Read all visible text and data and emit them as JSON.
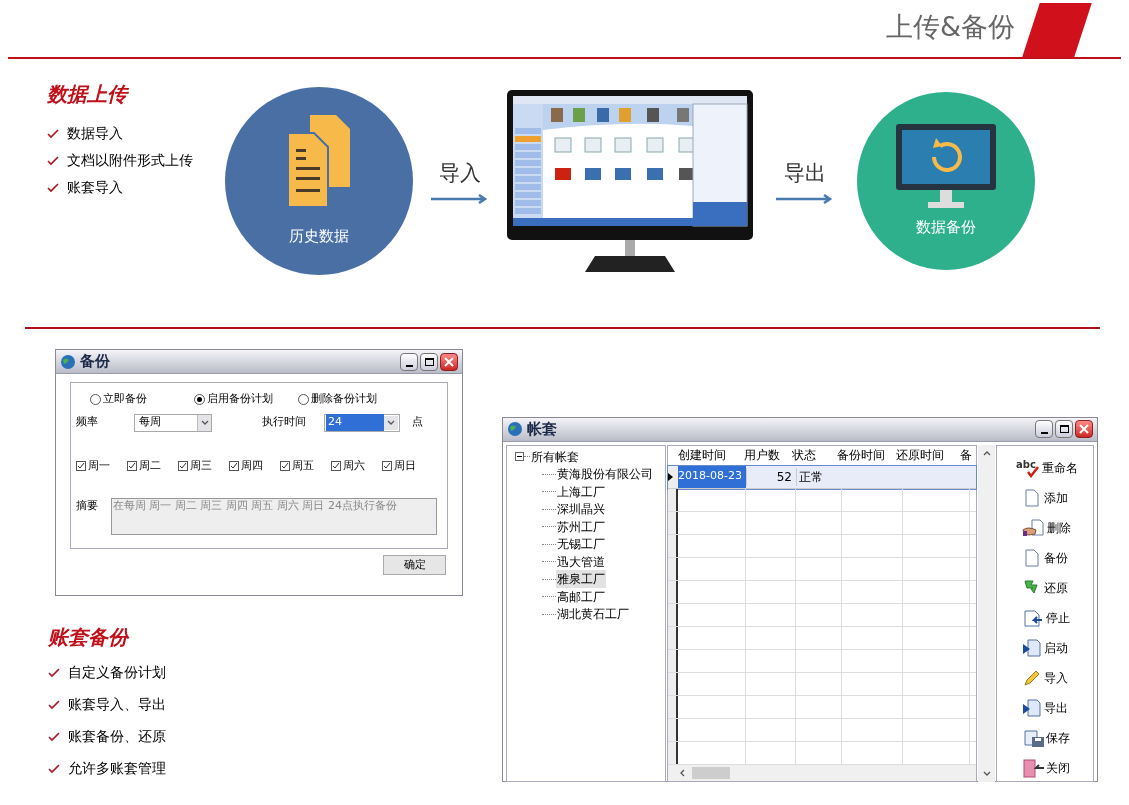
{
  "header": {
    "title": "上传&备份"
  },
  "upload": {
    "heading": "数据上传",
    "bullets": [
      "数据导入",
      "文档以附件形式上传",
      "账套导入"
    ]
  },
  "flow": {
    "source_label": "历史数据",
    "import_label": "导入",
    "export_label": "导出",
    "target_label": "数据备份"
  },
  "backup_dialog": {
    "title": "备份",
    "modes": [
      {
        "label": "立即备份",
        "selected": false
      },
      {
        "label": "启用备份计划",
        "selected": true
      },
      {
        "label": "删除备份计划",
        "selected": false
      }
    ],
    "frequency_label": "频率",
    "frequency": "每周",
    "time_label": "执行时间",
    "time": "24",
    "time_unit": "点",
    "days": [
      {
        "label": "周一",
        "checked": true
      },
      {
        "label": "周二",
        "checked": true
      },
      {
        "label": "周三",
        "checked": true
      },
      {
        "label": "周四",
        "checked": true
      },
      {
        "label": "周五",
        "checked": true
      },
      {
        "label": "周六",
        "checked": true
      },
      {
        "label": "周日",
        "checked": true
      }
    ],
    "summary_label": "摘要",
    "summary": "在每周 周一 周二 周三 周四 周五 周六 周日 24点执行备份",
    "ok_button": "确定"
  },
  "account_backup": {
    "heading": "账套备份",
    "bullets": [
      "自定义备份计划",
      "账套导入、导出",
      "账套备份、还原",
      "允许多账套管理"
    ]
  },
  "accounts_window": {
    "title": "帐套",
    "tree": {
      "label": "所有帐套",
      "expanded": true,
      "children": [
        {
          "label": "黄海股份有限公司",
          "selected": false
        },
        {
          "label": "上海工厂",
          "selected": false
        },
        {
          "label": "深圳晶兴",
          "selected": false
        },
        {
          "label": "苏州工厂",
          "selected": false
        },
        {
          "label": "无锡工厂",
          "selected": false
        },
        {
          "label": "迅大管道",
          "selected": false
        },
        {
          "label": "雅泉工厂",
          "selected": true
        },
        {
          "label": "高邮工厂",
          "selected": false
        },
        {
          "label": "湖北黄石工厂",
          "selected": false
        }
      ]
    },
    "columns": [
      "创建时间",
      "用户数",
      "状态",
      "备份时间",
      "还原时间",
      "备"
    ],
    "rows": [
      {
        "created": "2018-08-23",
        "users": "52",
        "status": "正常",
        "selected": true
      }
    ],
    "actions": [
      {
        "label": "重命名",
        "kind": "rename",
        "icon_text": "abc"
      },
      {
        "label": "添加",
        "kind": "add"
      },
      {
        "label": "删除",
        "kind": "delete"
      },
      {
        "label": "备份",
        "kind": "backup"
      },
      {
        "label": "还原",
        "kind": "restore"
      },
      {
        "label": "停止",
        "kind": "stop"
      },
      {
        "label": "启动",
        "kind": "start"
      },
      {
        "label": "导入",
        "kind": "import"
      },
      {
        "label": "导出",
        "kind": "export"
      },
      {
        "label": "保存",
        "kind": "save"
      },
      {
        "label": "关闭",
        "kind": "close"
      }
    ]
  }
}
